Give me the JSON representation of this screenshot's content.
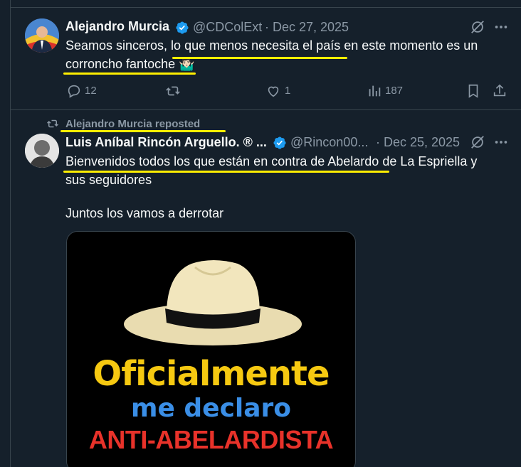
{
  "tweet1": {
    "author_name": "Alejandro Murcia",
    "handle": "@CDColExt",
    "date": "· Dec 27, 2025",
    "text_line1": "Seamos sinceros, lo que menos necesita el país en este momento es un",
    "text_line2": "corroncho fantoche 🤷🏻‍♂️",
    "replies": "12",
    "likes": "1",
    "views": "187"
  },
  "repost": {
    "label": "Alejandro Murcia reposted"
  },
  "tweet2": {
    "author_name": "Luis Aníbal Rincón Arguello. ® ...",
    "handle": "@Rincon00...",
    "date": "· Dec 25, 2025",
    "text_line1": "Bienvenidos todos los que están en contra de Abelardo de La Espriella y",
    "text_line2": "sus seguidores",
    "text_line3": "Juntos los vamos a derrotar",
    "image": {
      "line1": "Oficialmente",
      "line2": "me declaro",
      "line3": "ANTI-ABELARDISTA"
    }
  },
  "icons": {
    "grok": "grok-icon",
    "more": "more-icon",
    "reply": "reply-icon",
    "retweet": "retweet-icon",
    "like": "heart-icon",
    "views": "views-icon",
    "bookmark": "bookmark-icon",
    "share": "share-icon",
    "verified": "verified-icon"
  },
  "colors": {
    "background": "#15202b",
    "muted": "#8b98a5",
    "verified": "#1d9bf0",
    "highlight": "#ffee00"
  }
}
